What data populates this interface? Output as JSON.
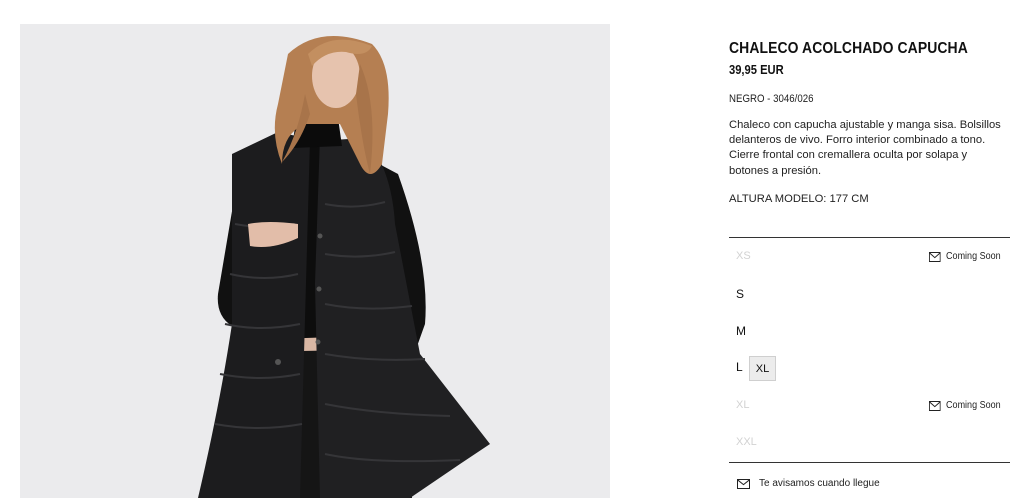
{
  "product": {
    "name": "CHALECO ACOLCHADO CAPUCHA",
    "price": "39,95 EUR",
    "color_ref": "NEGRO - 3046/026",
    "description": "Chaleco con capucha ajustable y manga sisa. Bolsillos delanteros de vivo. Forro interior combinado a tono. Cierre frontal con cremallera oculta por solapa y botones a presión.",
    "model_height": "ALTURA MODELO: 177 CM"
  },
  "sizes": [
    {
      "label": "XS",
      "available": false,
      "notice": "Coming Soon"
    },
    {
      "label": "S",
      "available": true,
      "notice": ""
    },
    {
      "label": "M",
      "available": true,
      "notice": ""
    },
    {
      "label": "L",
      "available": true,
      "notice": ""
    },
    {
      "label": "XL",
      "available": false,
      "notice": "Coming Soon"
    },
    {
      "label": "XXL",
      "available": false,
      "notice": ""
    }
  ],
  "selected_size_chip": "XL",
  "notify_link": "Te avisamos cuando llegue",
  "icons": {
    "coming_soon": "envelope-icon",
    "notify": "envelope-icon"
  },
  "colors": {
    "background": "#ffffff",
    "photo_bg": "#ebebed",
    "text": "#1a1a1a",
    "unavailable": "#d2d2d2"
  }
}
